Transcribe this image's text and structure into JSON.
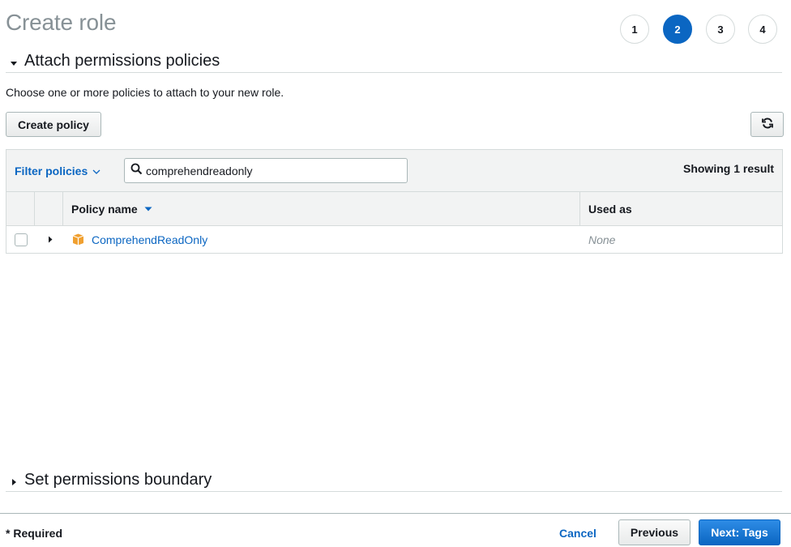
{
  "page": {
    "title": "Create role"
  },
  "steps": [
    {
      "label": "1",
      "active": false
    },
    {
      "label": "2",
      "active": true
    },
    {
      "label": "3",
      "active": false
    },
    {
      "label": "4",
      "active": false
    }
  ],
  "attach_section": {
    "title": "Attach permissions policies",
    "expanded": true,
    "description": "Choose one or more policies to attach to your new role.",
    "create_policy_label": "Create policy",
    "refresh_icon": "refresh-icon"
  },
  "filter": {
    "label": "Filter policies",
    "search_value": "comprehendreadonly",
    "results_text": "Showing 1 result"
  },
  "table": {
    "columns": {
      "name": "Policy name",
      "used_as": "Used as"
    },
    "sort": "descending",
    "rows": [
      {
        "name": "ComprehendReadOnly",
        "used_as": "None",
        "checked": false,
        "icon": "aws-managed-policy-icon"
      }
    ]
  },
  "boundary_section": {
    "title": "Set permissions boundary",
    "expanded": false
  },
  "footer": {
    "required_label": "* Required",
    "cancel_label": "Cancel",
    "previous_label": "Previous",
    "next_label": "Next: Tags"
  },
  "colors": {
    "accent": "#0b66c2",
    "title_gray": "#879196",
    "policy_icon": "#f0a030",
    "border": "#d5dbdb"
  }
}
